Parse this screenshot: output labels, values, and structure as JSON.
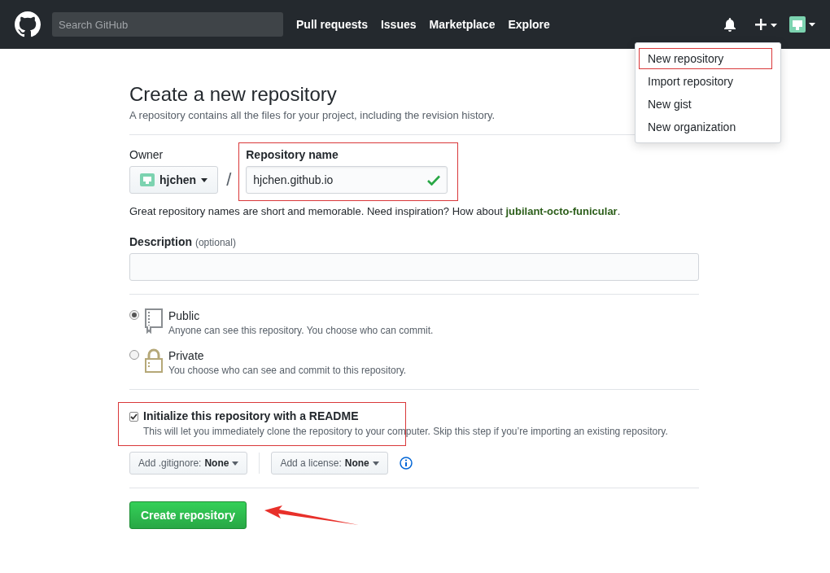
{
  "header": {
    "search": {
      "placeholder": "Search GitHub"
    },
    "nav": [
      "Pull requests",
      "Issues",
      "Marketplace",
      "Explore"
    ]
  },
  "new_menu": {
    "items": [
      {
        "label": "New repository",
        "highlighted": true
      },
      {
        "label": "Import repository",
        "highlighted": false
      },
      {
        "label": "New gist",
        "highlighted": false
      },
      {
        "label": "New organization",
        "highlighted": false
      }
    ]
  },
  "page": {
    "title": "Create a new repository",
    "subtitle": "A repository contains all the files for your project, including the revision history."
  },
  "owner": {
    "label": "Owner",
    "value": "hjchen",
    "separator": "/"
  },
  "repo_name": {
    "label": "Repository name",
    "value": "hjchen.github.io",
    "valid": true,
    "highlighted": true
  },
  "name_hint": "Great repository names are short and memorable. Need inspiration? How about **jubilant-octo-funicular**.",
  "description": {
    "label": "Description",
    "note": "(optional)"
  },
  "visibility": [
    {
      "kind": "book",
      "label": "Public",
      "text": "Anyone can see this repository. You choose who can commit.",
      "selected": true
    },
    {
      "kind": "lock",
      "label": "Private",
      "text": "You choose who can see and commit to this repository.",
      "selected": false
    }
  ],
  "readme": {
    "label": "Initialize this repository with a README",
    "text": "This will let you immediately clone the repository to your computer. Skip this step if you’re importing an existing repository.",
    "checked": true,
    "highlighted": true
  },
  "gitignore": {
    "label": "Add .gitignore:",
    "value": "None"
  },
  "license": {
    "label": "Add a license:",
    "value": "None"
  },
  "submit": {
    "label": "Create repository",
    "pointed": true
  }
}
